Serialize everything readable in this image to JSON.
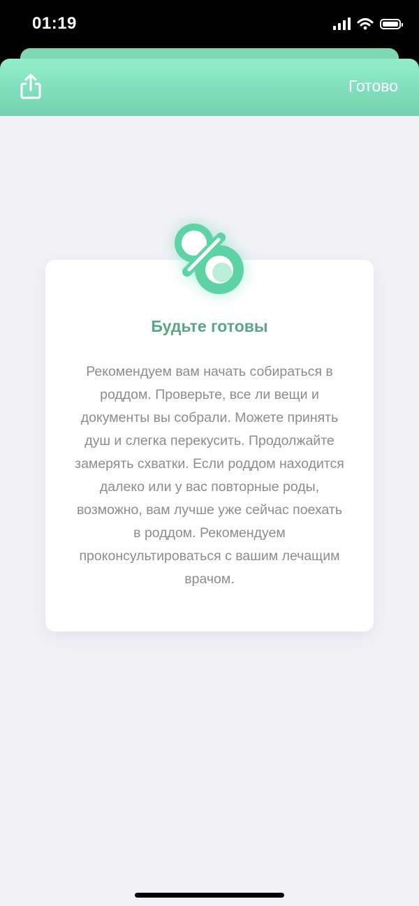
{
  "status_bar": {
    "time": "01:19"
  },
  "header": {
    "done_label": "Готово"
  },
  "card": {
    "title": "Будьте готовы",
    "body": "Рекомендуем вам начать собираться в роддом. Проверьте, все ли вещи и документы вы собрали. Можете принять душ и слегка перекусить. Продолжайте замерять схватки. Если роддом находится далеко или у вас повторные роды, возможно, вам лучше уже сейчас поехать в роддом. Рекомендуем проконсультироваться с вашим лечащим врачом."
  },
  "icons": {
    "share": "share-icon",
    "hero": "pacifier-icon",
    "signal": "signal-icon",
    "wifi": "wifi-icon",
    "battery": "battery-icon"
  },
  "colors": {
    "header_top": "#93edcc",
    "header_bottom": "#72d1b0",
    "accent_text": "#5aa586",
    "body_text": "#8c8c8c",
    "background": "#f1f1f6"
  }
}
